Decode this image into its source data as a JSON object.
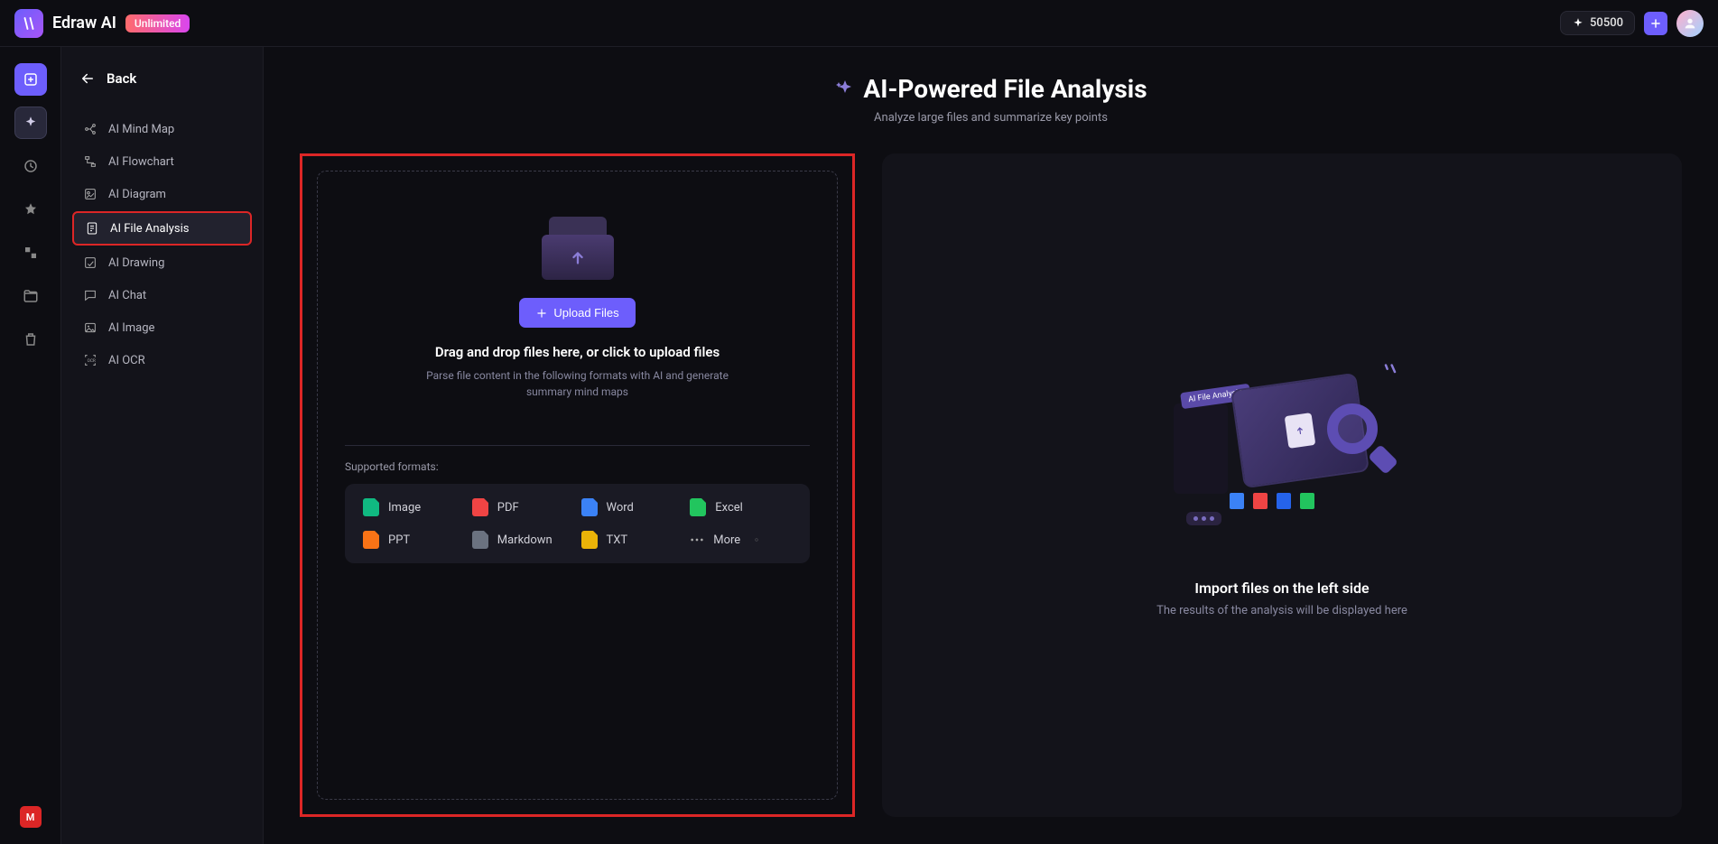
{
  "topbar": {
    "brand": "Edraw AI",
    "badge": "Unlimited",
    "credits": "50500"
  },
  "sidebar": {
    "back": "Back",
    "items": [
      {
        "label": "AI Mind Map"
      },
      {
        "label": "AI Flowchart"
      },
      {
        "label": "AI Diagram"
      },
      {
        "label": "AI File Analysis"
      },
      {
        "label": "AI Drawing"
      },
      {
        "label": "AI Chat"
      },
      {
        "label": "AI Image"
      },
      {
        "label": "AI OCR"
      }
    ]
  },
  "rail": {
    "bottom_badge": "M"
  },
  "page": {
    "title": "AI-Powered File Analysis",
    "subtitle": "Analyze large files and summarize key points"
  },
  "upload": {
    "button": "Upload Files",
    "drop_title": "Drag and drop files here, or click to upload files",
    "drop_desc": "Parse file content in the following formats with AI and generate summary mind maps",
    "formats_label": "Supported formats:",
    "formats": [
      {
        "label": "Image",
        "color": "#10b981"
      },
      {
        "label": "PDF",
        "color": "#ef4444"
      },
      {
        "label": "Word",
        "color": "#3b82f6"
      },
      {
        "label": "Excel",
        "color": "#22c55e"
      },
      {
        "label": "PPT",
        "color": "#f97316"
      },
      {
        "label": "Markdown",
        "color": "#6b7280"
      },
      {
        "label": "TXT",
        "color": "#eab308"
      }
    ],
    "more_label": "More"
  },
  "right": {
    "tag": "AI File Analysis",
    "title": "Import files on the left side",
    "desc": "The results of the analysis will be displayed here"
  }
}
